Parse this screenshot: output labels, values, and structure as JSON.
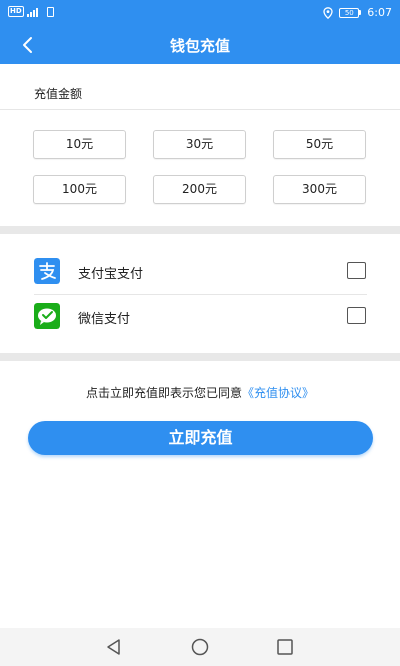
{
  "statusbar": {
    "network": "HD",
    "battery_level": "50",
    "time": "6:07"
  },
  "header": {
    "title": "钱包充值",
    "back_icon": "chevron-left-icon"
  },
  "amount_section": {
    "label": "充值金额",
    "options": [
      "10元",
      "30元",
      "50元",
      "100元",
      "200元",
      "300元"
    ]
  },
  "payment_methods": [
    {
      "label": "支付宝支付",
      "icon": "alipay-icon",
      "checked": false,
      "color": "#2f8ff0"
    },
    {
      "label": "微信支付",
      "icon": "wechat-pay-icon",
      "checked": false,
      "color": "#1aad19"
    }
  ],
  "agreement": {
    "prefix": "点击立即充值即表示您已同意",
    "link": "《充值协议》"
  },
  "submit": {
    "label": "立即充值"
  },
  "colors": {
    "primary": "#2f8ff0",
    "divider": "#e8e8e8"
  },
  "navbar": {
    "icons": [
      "back-triangle-icon",
      "home-circle-icon",
      "recents-square-icon"
    ]
  }
}
